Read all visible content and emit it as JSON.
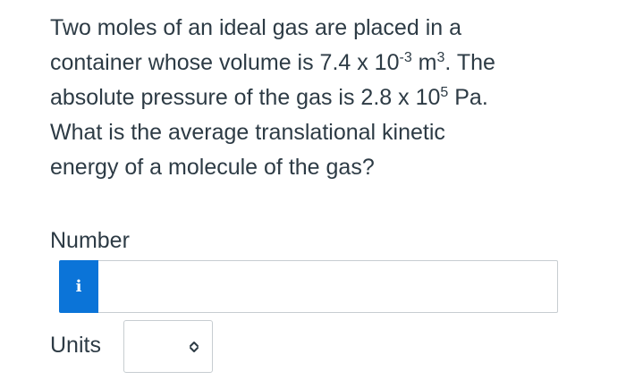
{
  "question": {
    "line1": "Two moles of an ideal gas are placed in a",
    "line2_prefix": "container whose volume is 7.4 x 10",
    "line2_exp1": "-3",
    "line2_mid": " m",
    "line2_exp2": "3",
    "line2_suffix": ". The",
    "line3_prefix": "absolute pressure of the gas is 2.8 x 10",
    "line3_exp": "5",
    "line3_suffix": " Pa.",
    "line4": "What is the average translational kinetic",
    "line5": "energy of a molecule of the gas?"
  },
  "answer": {
    "number_label": "Number",
    "info_icon_label": "i",
    "info_icon": "info-icon",
    "number_value": "",
    "units_label": "Units",
    "units_selected": "",
    "units_icon": "chevron-up-down-icon"
  },
  "colors": {
    "text": "#2d3b45",
    "info_button": "#0b74d8",
    "border": "#c7cdd1"
  }
}
